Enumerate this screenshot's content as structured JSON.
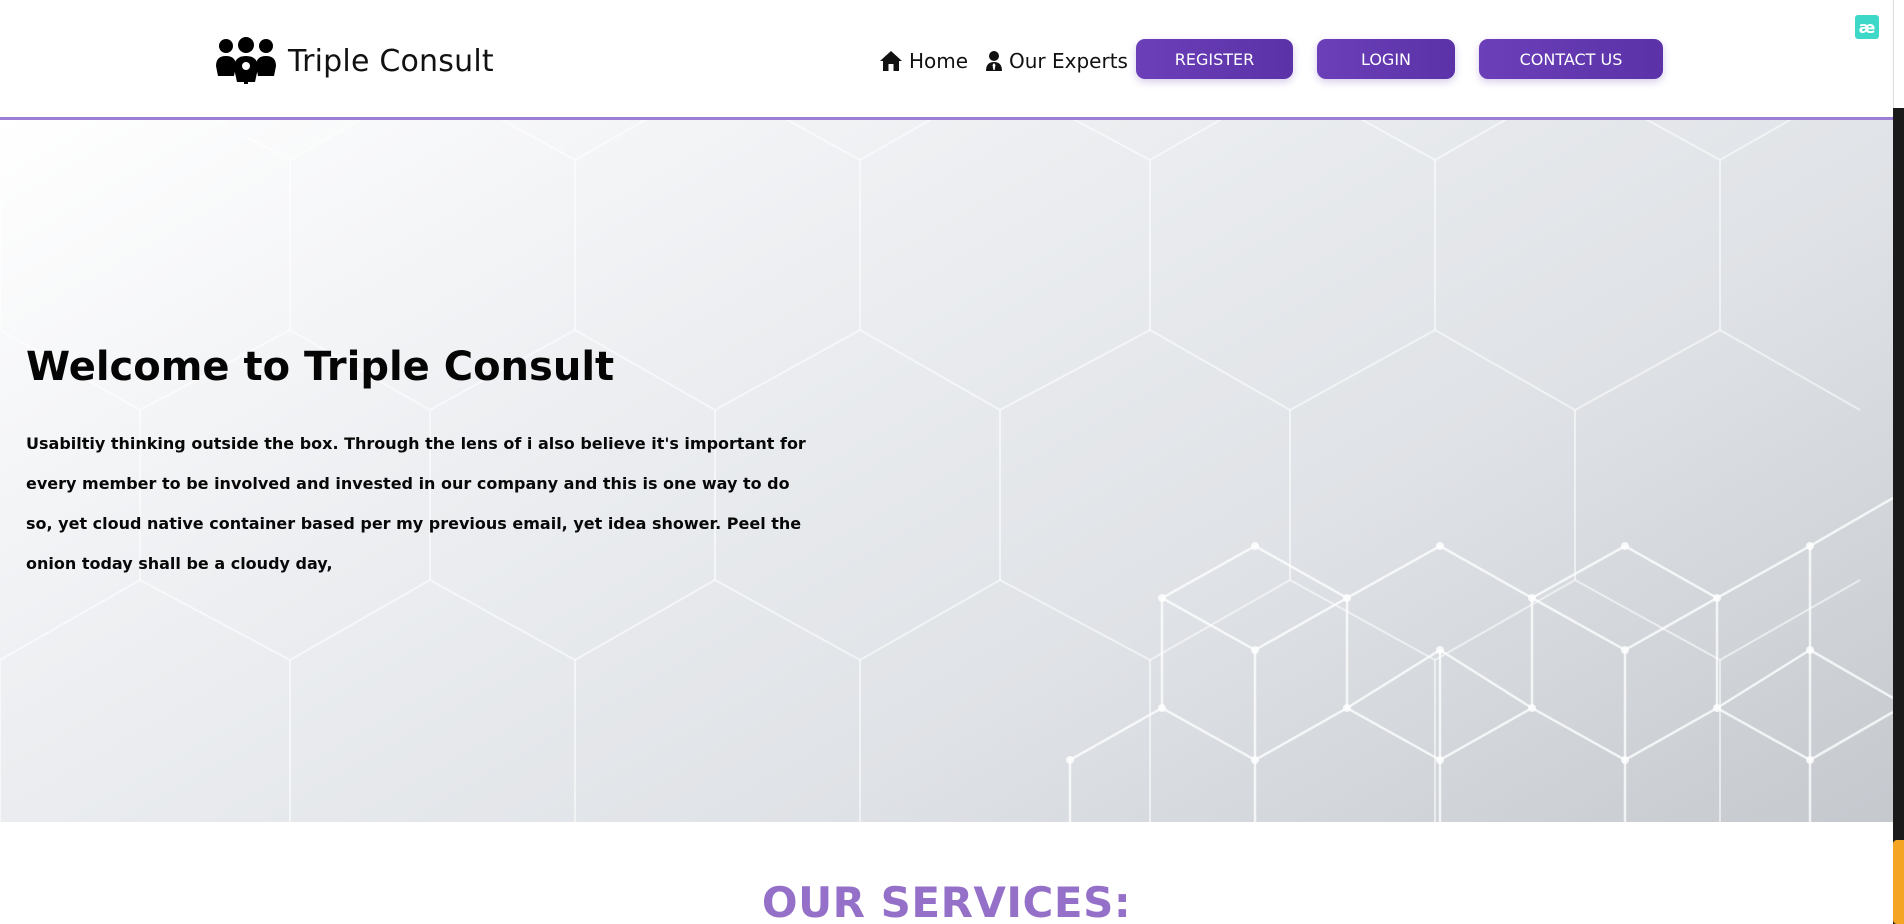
{
  "brand": {
    "name": "Triple Consult",
    "logo_icon": "people-group-icon"
  },
  "nav": {
    "home_label": "Home",
    "home_icon": "home-icon",
    "experts_label": "Our Experts",
    "experts_icon": "user-tie-icon",
    "register_label": "REGISTER",
    "login_label": "LOGIN",
    "contact_label": "CONTACT US"
  },
  "corner_badge": "æ",
  "hero": {
    "title": "Welcome to Triple Consult",
    "body": "Usabiltiy thinking outside the box. Through the lens of i also believe it's important for every member to be involved and invested in our company and this is one way to do so, yet cloud native container based per my previous email, yet idea shower. Peel the onion today shall be a cloudy day,"
  },
  "services": {
    "title": "OUR SERVICES:"
  },
  "colors": {
    "accent_purple": "#6b3fb8",
    "header_border": "#9b7fd4",
    "services_title": "#9470c8",
    "badge_teal": "#3ed8c8",
    "scroll_thumb": "#f5a524"
  }
}
